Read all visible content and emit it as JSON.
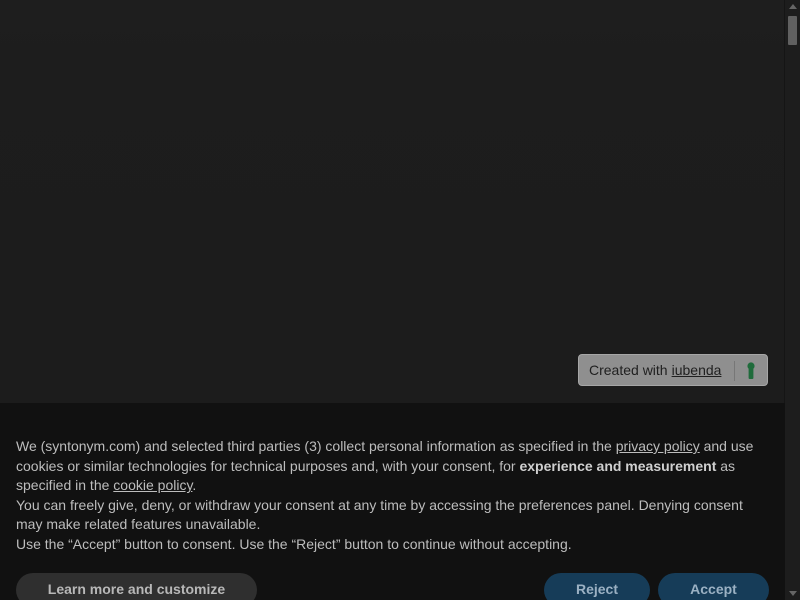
{
  "badge": {
    "prefix": "Created with",
    "link": "iubenda",
    "logo_icon": "iubenda-keyhole-icon",
    "logo_color": "#1f6b3b"
  },
  "banner": {
    "p1": {
      "t1": "We (syntonym.com) and selected third parties (3) collect personal information as specified in the ",
      "privacy_link": "privacy policy",
      "t2": " and use cookies or similar technologies for technical purposes and, with your consent, for ",
      "bold": "experience and measurement",
      "t3": " as specified in the ",
      "cookie_link": "cookie policy",
      "t4": "."
    },
    "p2": "You can freely give, deny, or withdraw your consent at any time by accessing the preferences panel. Denying consent may make related features unavailable.",
    "p3": "Use the “Accept” button to consent. Use the “Reject” button to continue without accepting.",
    "buttons": {
      "customize": "Learn more and customize",
      "reject": "Reject",
      "accept": "Accept"
    }
  },
  "colors": {
    "overlay": "#1c1c1c",
    "banner_bg": "#111111",
    "primary_button": "#163c58"
  }
}
